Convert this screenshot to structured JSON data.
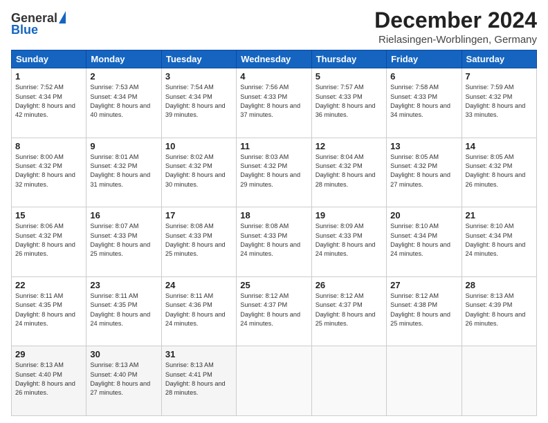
{
  "header": {
    "logo_general": "General",
    "logo_blue": "Blue",
    "main_title": "December 2024",
    "subtitle": "Rielasingen-Worblingen, Germany"
  },
  "calendar": {
    "days_of_week": [
      "Sunday",
      "Monday",
      "Tuesday",
      "Wednesday",
      "Thursday",
      "Friday",
      "Saturday"
    ],
    "weeks": [
      [
        null,
        {
          "day": "2",
          "sunrise": "Sunrise: 7:53 AM",
          "sunset": "Sunset: 4:34 PM",
          "daylight": "Daylight: 8 hours and 40 minutes."
        },
        {
          "day": "3",
          "sunrise": "Sunrise: 7:54 AM",
          "sunset": "Sunset: 4:34 PM",
          "daylight": "Daylight: 8 hours and 39 minutes."
        },
        {
          "day": "4",
          "sunrise": "Sunrise: 7:56 AM",
          "sunset": "Sunset: 4:33 PM",
          "daylight": "Daylight: 8 hours and 37 minutes."
        },
        {
          "day": "5",
          "sunrise": "Sunrise: 7:57 AM",
          "sunset": "Sunset: 4:33 PM",
          "daylight": "Daylight: 8 hours and 36 minutes."
        },
        {
          "day": "6",
          "sunrise": "Sunrise: 7:58 AM",
          "sunset": "Sunset: 4:33 PM",
          "daylight": "Daylight: 8 hours and 34 minutes."
        },
        {
          "day": "7",
          "sunrise": "Sunrise: 7:59 AM",
          "sunset": "Sunset: 4:32 PM",
          "daylight": "Daylight: 8 hours and 33 minutes."
        }
      ],
      [
        {
          "day": "8",
          "sunrise": "Sunrise: 8:00 AM",
          "sunset": "Sunset: 4:32 PM",
          "daylight": "Daylight: 8 hours and 32 minutes."
        },
        {
          "day": "9",
          "sunrise": "Sunrise: 8:01 AM",
          "sunset": "Sunset: 4:32 PM",
          "daylight": "Daylight: 8 hours and 31 minutes."
        },
        {
          "day": "10",
          "sunrise": "Sunrise: 8:02 AM",
          "sunset": "Sunset: 4:32 PM",
          "daylight": "Daylight: 8 hours and 30 minutes."
        },
        {
          "day": "11",
          "sunrise": "Sunrise: 8:03 AM",
          "sunset": "Sunset: 4:32 PM",
          "daylight": "Daylight: 8 hours and 29 minutes."
        },
        {
          "day": "12",
          "sunrise": "Sunrise: 8:04 AM",
          "sunset": "Sunset: 4:32 PM",
          "daylight": "Daylight: 8 hours and 28 minutes."
        },
        {
          "day": "13",
          "sunrise": "Sunrise: 8:05 AM",
          "sunset": "Sunset: 4:32 PM",
          "daylight": "Daylight: 8 hours and 27 minutes."
        },
        {
          "day": "14",
          "sunrise": "Sunrise: 8:05 AM",
          "sunset": "Sunset: 4:32 PM",
          "daylight": "Daylight: 8 hours and 26 minutes."
        }
      ],
      [
        {
          "day": "15",
          "sunrise": "Sunrise: 8:06 AM",
          "sunset": "Sunset: 4:32 PM",
          "daylight": "Daylight: 8 hours and 26 minutes."
        },
        {
          "day": "16",
          "sunrise": "Sunrise: 8:07 AM",
          "sunset": "Sunset: 4:33 PM",
          "daylight": "Daylight: 8 hours and 25 minutes."
        },
        {
          "day": "17",
          "sunrise": "Sunrise: 8:08 AM",
          "sunset": "Sunset: 4:33 PM",
          "daylight": "Daylight: 8 hours and 25 minutes."
        },
        {
          "day": "18",
          "sunrise": "Sunrise: 8:08 AM",
          "sunset": "Sunset: 4:33 PM",
          "daylight": "Daylight: 8 hours and 24 minutes."
        },
        {
          "day": "19",
          "sunrise": "Sunrise: 8:09 AM",
          "sunset": "Sunset: 4:33 PM",
          "daylight": "Daylight: 8 hours and 24 minutes."
        },
        {
          "day": "20",
          "sunrise": "Sunrise: 8:10 AM",
          "sunset": "Sunset: 4:34 PM",
          "daylight": "Daylight: 8 hours and 24 minutes."
        },
        {
          "day": "21",
          "sunrise": "Sunrise: 8:10 AM",
          "sunset": "Sunset: 4:34 PM",
          "daylight": "Daylight: 8 hours and 24 minutes."
        }
      ],
      [
        {
          "day": "22",
          "sunrise": "Sunrise: 8:11 AM",
          "sunset": "Sunset: 4:35 PM",
          "daylight": "Daylight: 8 hours and 24 minutes."
        },
        {
          "day": "23",
          "sunrise": "Sunrise: 8:11 AM",
          "sunset": "Sunset: 4:35 PM",
          "daylight": "Daylight: 8 hours and 24 minutes."
        },
        {
          "day": "24",
          "sunrise": "Sunrise: 8:11 AM",
          "sunset": "Sunset: 4:36 PM",
          "daylight": "Daylight: 8 hours and 24 minutes."
        },
        {
          "day": "25",
          "sunrise": "Sunrise: 8:12 AM",
          "sunset": "Sunset: 4:37 PM",
          "daylight": "Daylight: 8 hours and 24 minutes."
        },
        {
          "day": "26",
          "sunrise": "Sunrise: 8:12 AM",
          "sunset": "Sunset: 4:37 PM",
          "daylight": "Daylight: 8 hours and 25 minutes."
        },
        {
          "day": "27",
          "sunrise": "Sunrise: 8:12 AM",
          "sunset": "Sunset: 4:38 PM",
          "daylight": "Daylight: 8 hours and 25 minutes."
        },
        {
          "day": "28",
          "sunrise": "Sunrise: 8:13 AM",
          "sunset": "Sunset: 4:39 PM",
          "daylight": "Daylight: 8 hours and 26 minutes."
        }
      ],
      [
        {
          "day": "29",
          "sunrise": "Sunrise: 8:13 AM",
          "sunset": "Sunset: 4:40 PM",
          "daylight": "Daylight: 8 hours and 26 minutes."
        },
        {
          "day": "30",
          "sunrise": "Sunrise: 8:13 AM",
          "sunset": "Sunset: 4:40 PM",
          "daylight": "Daylight: 8 hours and 27 minutes."
        },
        {
          "day": "31",
          "sunrise": "Sunrise: 8:13 AM",
          "sunset": "Sunset: 4:41 PM",
          "daylight": "Daylight: 8 hours and 28 minutes."
        },
        null,
        null,
        null,
        null
      ]
    ],
    "first_day_extras": {
      "day": "1",
      "sunrise": "Sunrise: 7:52 AM",
      "sunset": "Sunset: 4:34 PM",
      "daylight": "Daylight: 8 hours and 42 minutes."
    }
  }
}
